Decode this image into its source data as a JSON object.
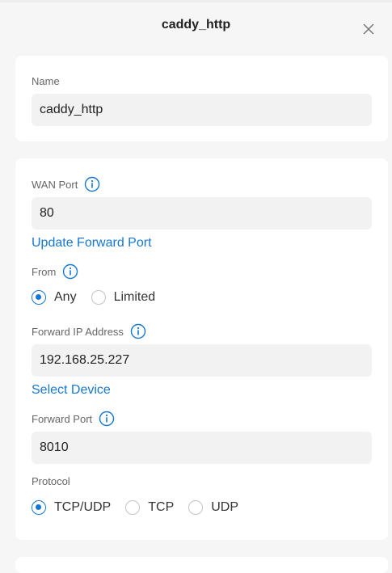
{
  "dialog": {
    "title": "caddy_http",
    "close_icon": "close-icon"
  },
  "name_section": {
    "label": "Name",
    "value": "caddy_http"
  },
  "wan_port": {
    "label": "WAN Port",
    "info_icon": "info-icon",
    "value": "80",
    "link": "Update Forward Port"
  },
  "from": {
    "label": "From",
    "info_icon": "info-icon",
    "options": [
      "Any",
      "Limited"
    ],
    "selected": "Any"
  },
  "forward_ip": {
    "label": "Forward IP Address",
    "info_icon": "info-icon",
    "value": "192.168.25.227",
    "link": "Select Device"
  },
  "forward_port": {
    "label": "Forward Port",
    "info_icon": "info-icon",
    "value": "8010"
  },
  "protocol": {
    "label": "Protocol",
    "options": [
      "TCP/UDP",
      "TCP",
      "UDP"
    ],
    "selected": "TCP/UDP"
  },
  "colors": {
    "accent": "#1677d2",
    "background": "#f6f6f6",
    "field": "#f2f2f2"
  }
}
